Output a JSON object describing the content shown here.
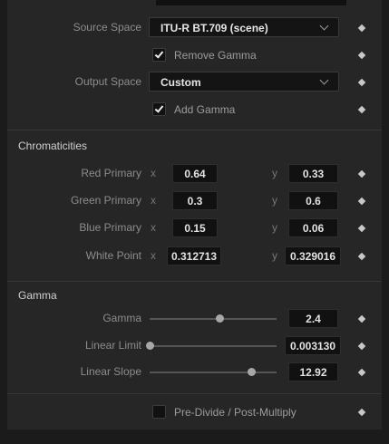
{
  "source_space": {
    "label": "Source Space",
    "value": "ITU-R BT.709 (scene)"
  },
  "remove_gamma": {
    "label": "Remove Gamma",
    "checked": true
  },
  "output_space": {
    "label": "Output Space",
    "value": "Custom"
  },
  "add_gamma": {
    "label": "Add Gamma",
    "checked": true
  },
  "chromaticities": {
    "title": "Chromaticities",
    "x_axis": "x",
    "y_axis": "y",
    "rows": [
      {
        "label": "Red Primary",
        "x": "0.64",
        "y": "0.33"
      },
      {
        "label": "Green Primary",
        "x": "0.3",
        "y": "0.6"
      },
      {
        "label": "Blue Primary",
        "x": "0.15",
        "y": "0.06"
      },
      {
        "label": "White Point",
        "x": "0.312713",
        "y": "0.329016"
      }
    ]
  },
  "gamma": {
    "title": "Gamma",
    "rows": [
      {
        "label": "Gamma",
        "value": "2.4",
        "slider_fraction": 0.55
      },
      {
        "label": "Linear Limit",
        "value": "0.003130",
        "slider_fraction": 0.0
      },
      {
        "label": "Linear Slope",
        "value": "12.92",
        "slider_fraction": 0.8
      }
    ]
  },
  "predivide": {
    "label": "Pre-Divide / Post-Multiply",
    "checked": false
  }
}
